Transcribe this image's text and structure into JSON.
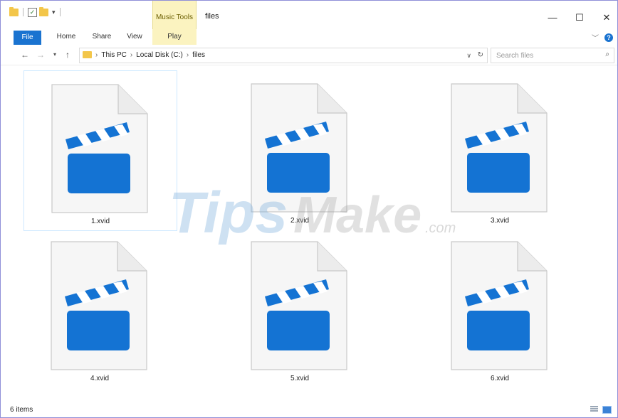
{
  "titlebar": {
    "context_tab_group": "Music Tools",
    "window_title": "files",
    "minimize_glyph": "—",
    "maximize_glyph": "☐",
    "close_glyph": "✕"
  },
  "ribbon": {
    "tabs": [
      {
        "label": "File"
      },
      {
        "label": "Home"
      },
      {
        "label": "Share"
      },
      {
        "label": "View"
      },
      {
        "label": "Play"
      }
    ]
  },
  "address": {
    "crumbs": [
      "This PC",
      "Local Disk (C:)",
      "files"
    ]
  },
  "search": {
    "placeholder": "Search files"
  },
  "files": [
    {
      "name": "1.xvid",
      "selected": true
    },
    {
      "name": "2.xvid",
      "selected": false
    },
    {
      "name": "3.xvid",
      "selected": false
    },
    {
      "name": "4.xvid",
      "selected": false
    },
    {
      "name": "5.xvid",
      "selected": false
    },
    {
      "name": "6.xvid",
      "selected": false
    }
  ],
  "status": {
    "item_count": "6 items"
  },
  "watermark": {
    "brand_tips": "Tips",
    "brand_make": "Make",
    "brand_com": ".com"
  },
  "colors": {
    "accent": "#1a73d0",
    "context_tab": "#fbf3c0",
    "file_icon_blue": "#1473d3",
    "folder_yellow": "#f3c64a",
    "window_border": "#8f8fd8"
  },
  "icons": {
    "file_icon": "video-clapperboard-file-icon",
    "folder": "folder-icon",
    "search": "search-icon",
    "refresh": "refresh-icon",
    "up": "up-arrow-icon",
    "back": "back-arrow-icon",
    "forward": "forward-arrow-icon",
    "help": "help-icon"
  }
}
